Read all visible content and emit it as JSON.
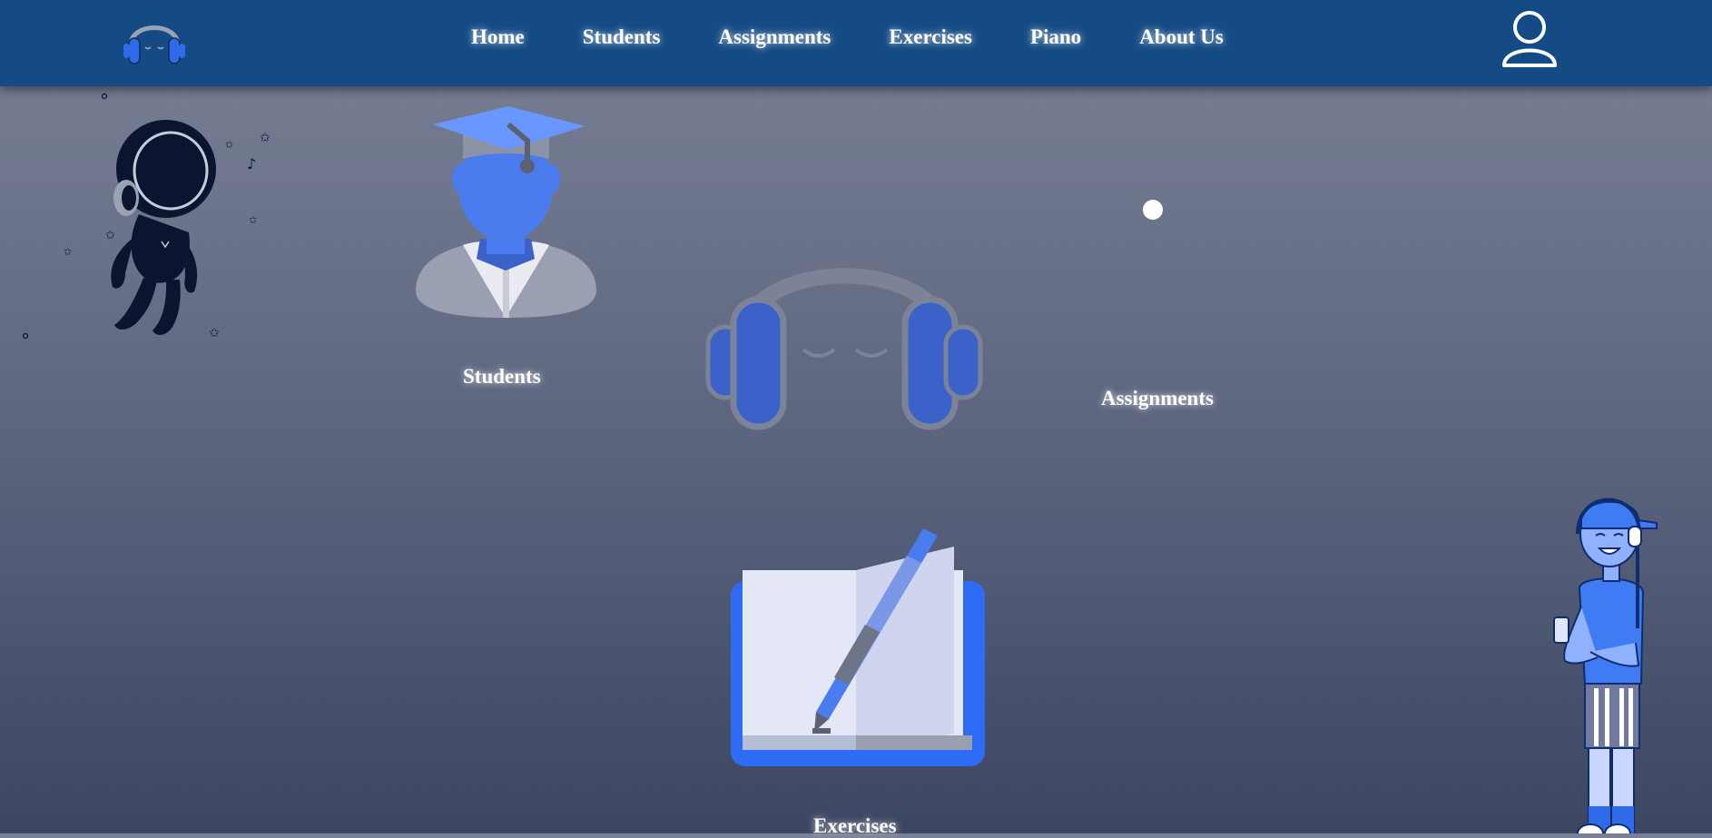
{
  "nav": {
    "links": [
      {
        "label": "Home"
      },
      {
        "label": "Students"
      },
      {
        "label": "Assignments"
      },
      {
        "label": "Exercises"
      },
      {
        "label": "Piano"
      },
      {
        "label": "About Us"
      }
    ],
    "logo_icon": "headphones-icon",
    "user_icon": "user-profile-icon"
  },
  "cards": {
    "students": {
      "label": "Students",
      "icon": "graduate-icon"
    },
    "assignments": {
      "label": "Assignments",
      "icon": "loading-dot-icon"
    },
    "exercises": {
      "label": "Exercises",
      "icon": "notebook-pen-icon"
    },
    "center": {
      "icon": "headphones-icon"
    }
  },
  "decorations": {
    "left": "astronaut-with-headphones-illustration",
    "right": "boy-with-headphones-illustration"
  },
  "colors": {
    "navbar": "#144b85",
    "accent_blue": "#4a7cf0",
    "dark_blue": "#3a62c9",
    "gray": "#8a8fa3"
  }
}
